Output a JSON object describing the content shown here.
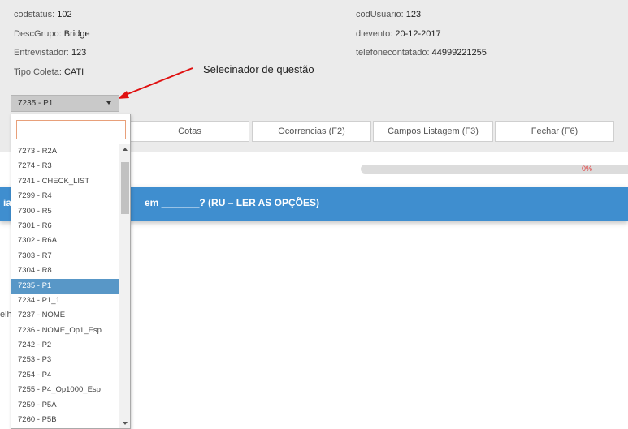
{
  "info": {
    "codstatus_label": "codstatus:",
    "codstatus_value": "102",
    "descgrupo_label": "DescGrupo:",
    "descgrupo_value": "Bridge",
    "entrevistador_label": "Entrevistador:",
    "entrevistador_value": "123",
    "tipocoleta_label": "Tipo Coleta:",
    "tipocoleta_value": "CATI",
    "codusuario_label": "codUsuario:",
    "codusuario_value": "123",
    "dtevento_label": "dtevento:",
    "dtevento_value": "20-12-2017",
    "telefone_label": "telefonecontatado:",
    "telefone_value": "44999221255"
  },
  "annotation": "Selecinador de questão",
  "selector": {
    "value": "7235 - P1"
  },
  "search": {
    "value": "",
    "placeholder": ""
  },
  "buttons": {
    "cotas": "Cotas",
    "ocorrencias": "Ocorrencias (F2)",
    "campos": "Campos Listagem (F3)",
    "fechar": "Fechar (F6)"
  },
  "progress": {
    "label": "0%",
    "value": 0
  },
  "question": {
    "text": "em _______? (RU – LER AS OPÇÕES)",
    "left_fragment": "ia"
  },
  "partial_text": "elho",
  "dropdown_items": [
    "7273 - R2A",
    "7274 - R3",
    "7241 - CHECK_LIST",
    "7299 - R4",
    "7300 - R5",
    "7301 - R6",
    "7302 - R6A",
    "7303 - R7",
    "7304 - R8",
    "7235 - P1",
    "7234 - P1_1",
    "7237 - NOME",
    "7236 - NOME_Op1_Esp",
    "7242 - P2",
    "7253 - P3",
    "7254 - P4",
    "7255 - P4_Op1000_Esp",
    "7259 - P5A",
    "7260 - P5B"
  ],
  "selected_index": 9,
  "colors": {
    "accent": "#3f8ecf",
    "selected": "#5897c7",
    "progress_text": "#e04545"
  }
}
